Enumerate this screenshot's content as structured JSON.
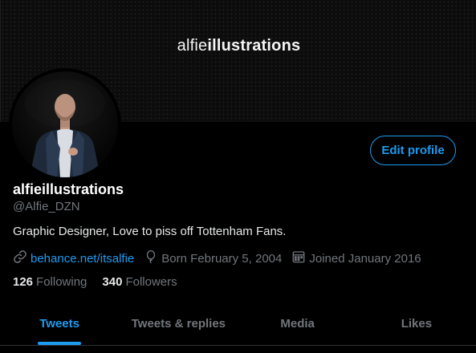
{
  "banner": {
    "title_light": "alfie",
    "title_bold": "illustrations"
  },
  "profile": {
    "display_name": "alfieillustrations",
    "handle": "@Alfie_DZN",
    "bio": "Graphic Designer, Love to piss off Tottenham Fans.",
    "website": "behance.net/itsalfie",
    "birthday": "Born February 5, 2004",
    "joined": "Joined January 2016",
    "edit_button_label": "Edit profile"
  },
  "stats": {
    "following_count": "126",
    "following_label": "Following",
    "followers_count": "340",
    "followers_label": "Followers"
  },
  "tabs": [
    {
      "label": "Tweets",
      "active": true
    },
    {
      "label": "Tweets & replies",
      "active": false
    },
    {
      "label": "Media",
      "active": false
    },
    {
      "label": "Likes",
      "active": false
    }
  ],
  "colors": {
    "accent": "#1d9bf0",
    "background": "#000000",
    "secondary_text": "#71767b",
    "primary_text": "#e7e9ea"
  },
  "icons": {
    "website": "link-icon",
    "birthday": "balloon-icon",
    "joined": "calendar-icon"
  }
}
